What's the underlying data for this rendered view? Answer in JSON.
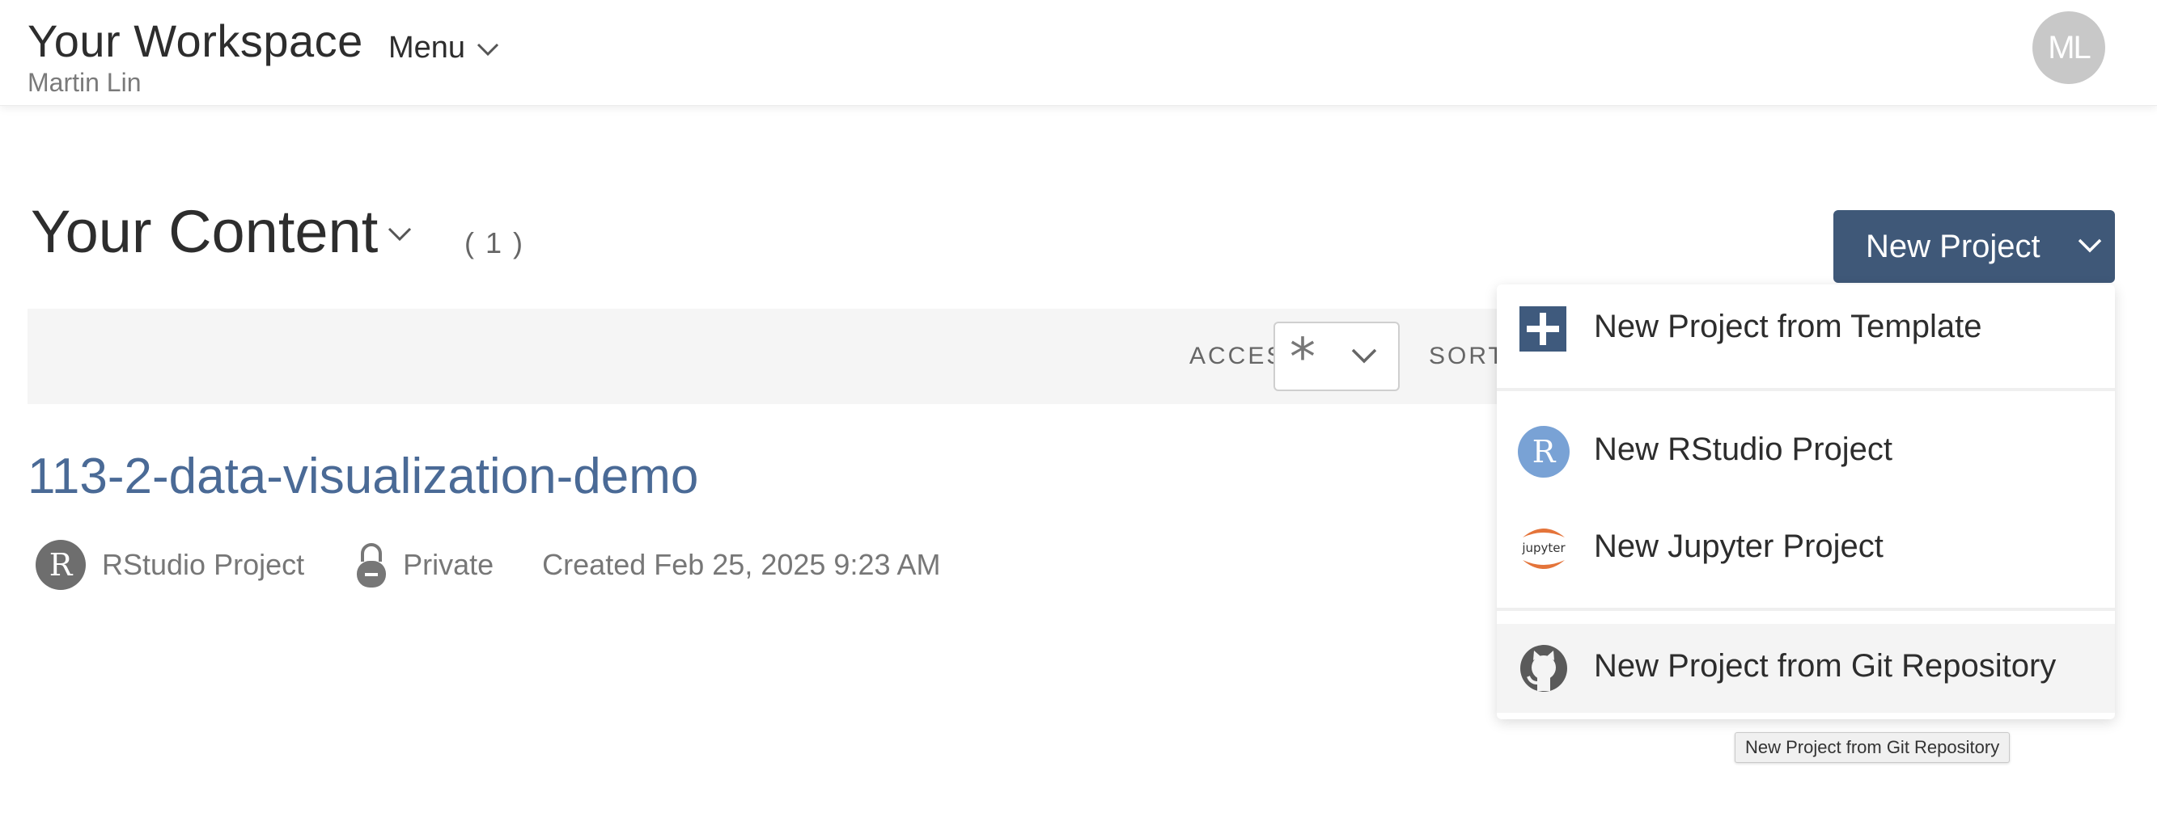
{
  "header": {
    "workspace_title": "Your Workspace",
    "user_name": "Martin Lin",
    "menu_label": "Menu",
    "avatar_initials": "ML"
  },
  "content": {
    "title": "Your Content",
    "count": "( 1 )"
  },
  "new_project_button": {
    "label": "New Project"
  },
  "filters": {
    "access_label": "ACCESS",
    "access_value": "*",
    "sort_label": "SORT"
  },
  "project": {
    "name": "113-2-data-visualization-demo",
    "type_badge": "R",
    "type": "RStudio Project",
    "privacy": "Private",
    "created": "Created Feb 25, 2025 9:23 AM"
  },
  "dropdown": {
    "items": [
      {
        "label": "New Project from Template",
        "icon": "plus-square-icon"
      },
      {
        "label": "New RStudio Project",
        "icon": "rstudio-icon",
        "badge": "R"
      },
      {
        "label": "New Jupyter Project",
        "icon": "jupyter-icon",
        "badge": "jupyter"
      },
      {
        "label": "New Project from Git Repository",
        "icon": "github-icon"
      }
    ]
  },
  "tooltip": {
    "text": "New Project from Git Repository"
  },
  "colors": {
    "primary_button": "#3f5878",
    "link": "#4a6a96",
    "rstudio_blue": "#79a2d5",
    "jupyter_orange": "#e4743a"
  }
}
